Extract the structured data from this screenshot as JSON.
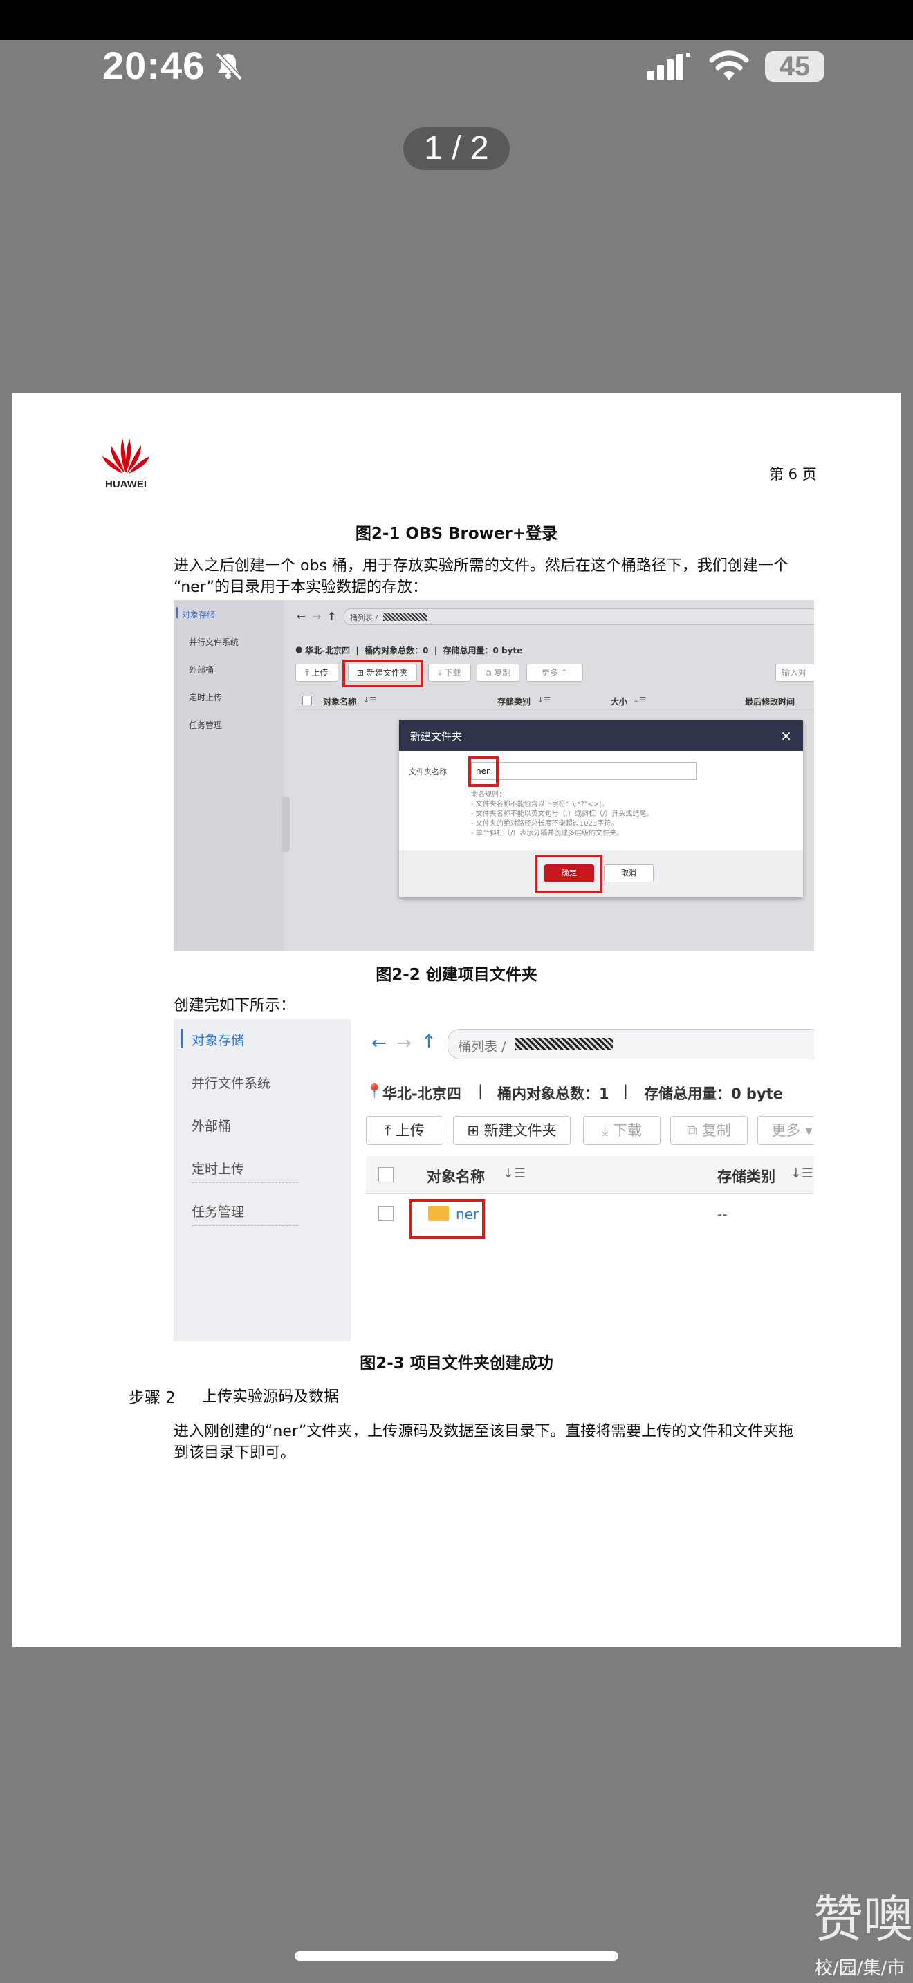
{
  "status": {
    "time": "20:46",
    "battery": "45"
  },
  "viewer": {
    "page_indicator": "1 / 2"
  },
  "watermark": {
    "line1": "赞噢",
    "line2": "校/园/集/市"
  },
  "doc": {
    "logo_text": "HUAWEI",
    "page_label": "第 6 页",
    "fig1_caption": "图2-1 OBS Brower+登录",
    "para1_line1": "进入之后创建一个 obs 桶，用于存放实验所需的文件。然后在这个桶路径下，我们创建一个",
    "para1_line2": "“ner”的目录用于本实验数据的存放：",
    "fig2_caption": "图2-2 创建项目文件夹",
    "para2": "创建完如下所示：",
    "fig3_caption": "图2-3 项目文件夹创建成功",
    "step_label": "步骤 2",
    "step_title": "上传实验源码及数据",
    "para3_line1": "进入刚创建的“ner”文件夹，上传源码及数据至该目录下。直接将需要上传的文件和文件夹拖",
    "para3_line2": "到该目录下即可。"
  },
  "shot1": {
    "sidebar": [
      "对象存储",
      "并行文件系统",
      "外部桶",
      "定时上传",
      "任务管理"
    ],
    "breadcrumb": "桶列表 /",
    "info": "华北-北京四  |  桶内对象总数：0  |  存储总用量：0 byte",
    "buttons": {
      "upload": "上传",
      "new_folder": "新建文件夹",
      "download": "下载",
      "copy": "复制",
      "more": "更多",
      "search": "输入对"
    },
    "columns": [
      "对象名称",
      "存储类别",
      "大小",
      "最后修改时间"
    ],
    "dialog": {
      "title": "新建文件夹",
      "close": "×",
      "field_label": "文件夹名称",
      "field_value": "ner",
      "hints": [
        "命名规则：",
        "- 文件夹名称不能包含以下字符：\\:*?\"<>|。",
        "- 文件夹名称不能以英文句号（.）或斜杠（/）开头或结尾。",
        "- 文件夹的绝对路径总长度不能超过1023字符。",
        "- 单个斜杠（/）表示分隔并创建多层级的文件夹。"
      ],
      "confirm": "确定",
      "cancel": "取消"
    }
  },
  "shot2": {
    "sidebar": [
      "对象存储",
      "并行文件系统",
      "外部桶",
      "定时上传",
      "任务管理"
    ],
    "breadcrumb": "桶列表 /",
    "info_region": "华北-北京四",
    "info_count": "桶内对象总数：1",
    "info_usage": "存储总用量：0 byte",
    "buttons": {
      "upload": "上传",
      "new_folder": "新建文件夹",
      "download": "下载",
      "copy": "复制",
      "more": "更多"
    },
    "columns": [
      "对象名称",
      "存储类别"
    ],
    "row": {
      "name": "ner",
      "storage": "--"
    }
  },
  "colors": {
    "background": "#7d7d7d",
    "highlight_red": "#d41e1e",
    "dialog_header": "#2e3449",
    "link_blue": "#2c79d6"
  }
}
